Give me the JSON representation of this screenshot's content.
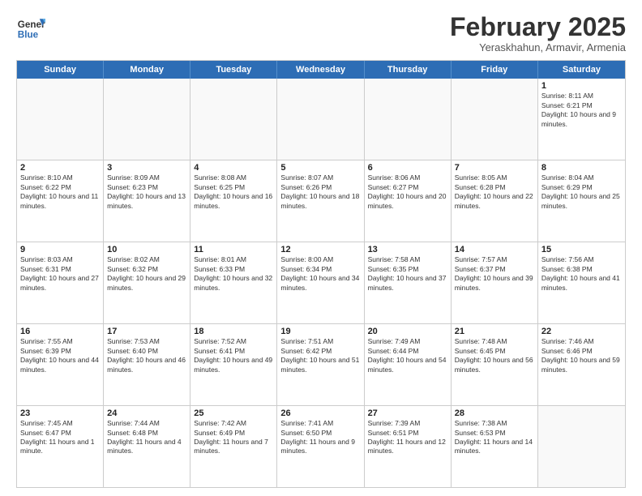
{
  "logo": {
    "general": "General",
    "blue": "Blue"
  },
  "header": {
    "title": "February 2025",
    "subtitle": "Yeraskhahun, Armavir, Armenia"
  },
  "weekdays": [
    "Sunday",
    "Monday",
    "Tuesday",
    "Wednesday",
    "Thursday",
    "Friday",
    "Saturday"
  ],
  "weeks": [
    [
      {
        "day": "",
        "info": ""
      },
      {
        "day": "",
        "info": ""
      },
      {
        "day": "",
        "info": ""
      },
      {
        "day": "",
        "info": ""
      },
      {
        "day": "",
        "info": ""
      },
      {
        "day": "",
        "info": ""
      },
      {
        "day": "1",
        "info": "Sunrise: 8:11 AM\nSunset: 6:21 PM\nDaylight: 10 hours and 9 minutes."
      }
    ],
    [
      {
        "day": "2",
        "info": "Sunrise: 8:10 AM\nSunset: 6:22 PM\nDaylight: 10 hours and 11 minutes."
      },
      {
        "day": "3",
        "info": "Sunrise: 8:09 AM\nSunset: 6:23 PM\nDaylight: 10 hours and 13 minutes."
      },
      {
        "day": "4",
        "info": "Sunrise: 8:08 AM\nSunset: 6:25 PM\nDaylight: 10 hours and 16 minutes."
      },
      {
        "day": "5",
        "info": "Sunrise: 8:07 AM\nSunset: 6:26 PM\nDaylight: 10 hours and 18 minutes."
      },
      {
        "day": "6",
        "info": "Sunrise: 8:06 AM\nSunset: 6:27 PM\nDaylight: 10 hours and 20 minutes."
      },
      {
        "day": "7",
        "info": "Sunrise: 8:05 AM\nSunset: 6:28 PM\nDaylight: 10 hours and 22 minutes."
      },
      {
        "day": "8",
        "info": "Sunrise: 8:04 AM\nSunset: 6:29 PM\nDaylight: 10 hours and 25 minutes."
      }
    ],
    [
      {
        "day": "9",
        "info": "Sunrise: 8:03 AM\nSunset: 6:31 PM\nDaylight: 10 hours and 27 minutes."
      },
      {
        "day": "10",
        "info": "Sunrise: 8:02 AM\nSunset: 6:32 PM\nDaylight: 10 hours and 29 minutes."
      },
      {
        "day": "11",
        "info": "Sunrise: 8:01 AM\nSunset: 6:33 PM\nDaylight: 10 hours and 32 minutes."
      },
      {
        "day": "12",
        "info": "Sunrise: 8:00 AM\nSunset: 6:34 PM\nDaylight: 10 hours and 34 minutes."
      },
      {
        "day": "13",
        "info": "Sunrise: 7:58 AM\nSunset: 6:35 PM\nDaylight: 10 hours and 37 minutes."
      },
      {
        "day": "14",
        "info": "Sunrise: 7:57 AM\nSunset: 6:37 PM\nDaylight: 10 hours and 39 minutes."
      },
      {
        "day": "15",
        "info": "Sunrise: 7:56 AM\nSunset: 6:38 PM\nDaylight: 10 hours and 41 minutes."
      }
    ],
    [
      {
        "day": "16",
        "info": "Sunrise: 7:55 AM\nSunset: 6:39 PM\nDaylight: 10 hours and 44 minutes."
      },
      {
        "day": "17",
        "info": "Sunrise: 7:53 AM\nSunset: 6:40 PM\nDaylight: 10 hours and 46 minutes."
      },
      {
        "day": "18",
        "info": "Sunrise: 7:52 AM\nSunset: 6:41 PM\nDaylight: 10 hours and 49 minutes."
      },
      {
        "day": "19",
        "info": "Sunrise: 7:51 AM\nSunset: 6:42 PM\nDaylight: 10 hours and 51 minutes."
      },
      {
        "day": "20",
        "info": "Sunrise: 7:49 AM\nSunset: 6:44 PM\nDaylight: 10 hours and 54 minutes."
      },
      {
        "day": "21",
        "info": "Sunrise: 7:48 AM\nSunset: 6:45 PM\nDaylight: 10 hours and 56 minutes."
      },
      {
        "day": "22",
        "info": "Sunrise: 7:46 AM\nSunset: 6:46 PM\nDaylight: 10 hours and 59 minutes."
      }
    ],
    [
      {
        "day": "23",
        "info": "Sunrise: 7:45 AM\nSunset: 6:47 PM\nDaylight: 11 hours and 1 minute."
      },
      {
        "day": "24",
        "info": "Sunrise: 7:44 AM\nSunset: 6:48 PM\nDaylight: 11 hours and 4 minutes."
      },
      {
        "day": "25",
        "info": "Sunrise: 7:42 AM\nSunset: 6:49 PM\nDaylight: 11 hours and 7 minutes."
      },
      {
        "day": "26",
        "info": "Sunrise: 7:41 AM\nSunset: 6:50 PM\nDaylight: 11 hours and 9 minutes."
      },
      {
        "day": "27",
        "info": "Sunrise: 7:39 AM\nSunset: 6:51 PM\nDaylight: 11 hours and 12 minutes."
      },
      {
        "day": "28",
        "info": "Sunrise: 7:38 AM\nSunset: 6:53 PM\nDaylight: 11 hours and 14 minutes."
      },
      {
        "day": "",
        "info": ""
      }
    ]
  ]
}
